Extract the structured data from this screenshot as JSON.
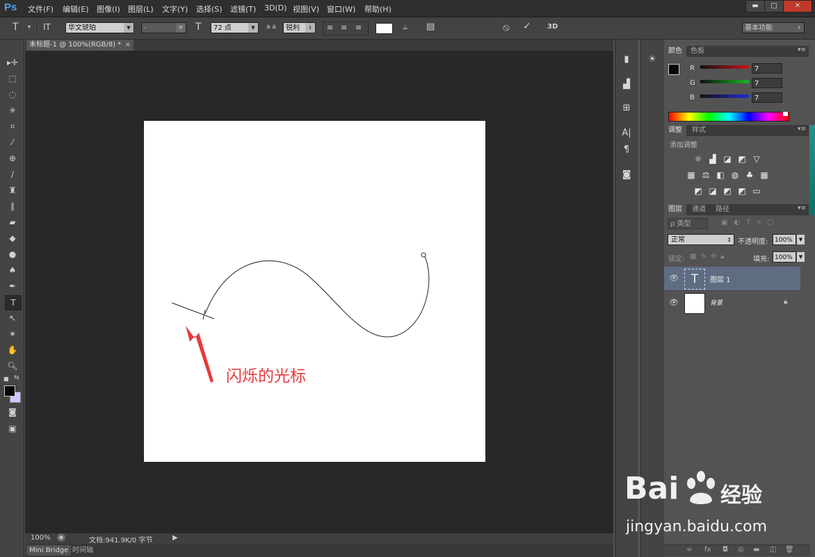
{
  "app": {
    "logo": "Ps"
  },
  "menu": [
    "文件(F)",
    "编辑(E)",
    "图像(I)",
    "图层(L)",
    "文字(Y)",
    "选择(S)",
    "滤镜(T)",
    "3D(D)",
    "视图(V)",
    "窗口(W)",
    "帮助(H)"
  ],
  "window_controls": {
    "minimize": "▬",
    "restore": "□",
    "close": "✕"
  },
  "options": {
    "tool_icon": "T",
    "orient_icon": "IT",
    "font_family": "华文琥珀",
    "font_style": "-",
    "size_icon": "T",
    "font_size": "72 点",
    "aa_icon": "a a",
    "antialias": "锐利",
    "cancel_icon": "⦸",
    "commit_icon": "✓",
    "threed_label": "3D",
    "workspace": "基本功能"
  },
  "document": {
    "tab_title": "未标题-1 @ 100%(RGB/8) *",
    "tab_close": "×",
    "annotation": "闪烁的光标",
    "annotation_color": "#e8393c"
  },
  "status": {
    "zoom": "100%",
    "doc_info": "文档:941.9K/0 字节",
    "arrow": "▶"
  },
  "bottom_tabs": [
    "Mini Bridge",
    "时间轴"
  ],
  "color_panel": {
    "tabs": [
      "颜色",
      "色板"
    ],
    "channels": [
      {
        "label": "R",
        "value": "7",
        "color": "#c8151b"
      },
      {
        "label": "G",
        "value": "7",
        "color": "#19b623"
      },
      {
        "label": "B",
        "value": "7",
        "color": "#1f2bd8"
      }
    ]
  },
  "adjust_panel": {
    "tabs": [
      "调整",
      "样式"
    ],
    "title": "添加调整",
    "row1": [
      "☼",
      "▟",
      "◪",
      "◩",
      "▽"
    ],
    "row2": [
      "▦",
      "⚖",
      "◧",
      "◍",
      "♣",
      "▦"
    ],
    "row3": [
      "◩",
      "◪",
      "◩",
      "◩",
      "▭"
    ]
  },
  "layers_panel": {
    "tabs": [
      "图层",
      "通道",
      "路径"
    ],
    "filter_label": "ρ 类型",
    "blend_mode": "正常",
    "opacity_label": "不透明度:",
    "opacity": "100%",
    "lock_label": "锁定:",
    "fill_label": "填充:",
    "fill": "100%",
    "layers": [
      {
        "name": "图层 1",
        "type": "text",
        "selected": true
      },
      {
        "name": "背景",
        "type": "background",
        "selected": false
      }
    ],
    "footer_icons": [
      "∞",
      "fx",
      "◘",
      "◎",
      "▬",
      "◫",
      "🗑"
    ]
  },
  "watermark": {
    "brand": "Bai",
    "brand2": "经验",
    "url": "jingyan.baidu.com"
  }
}
